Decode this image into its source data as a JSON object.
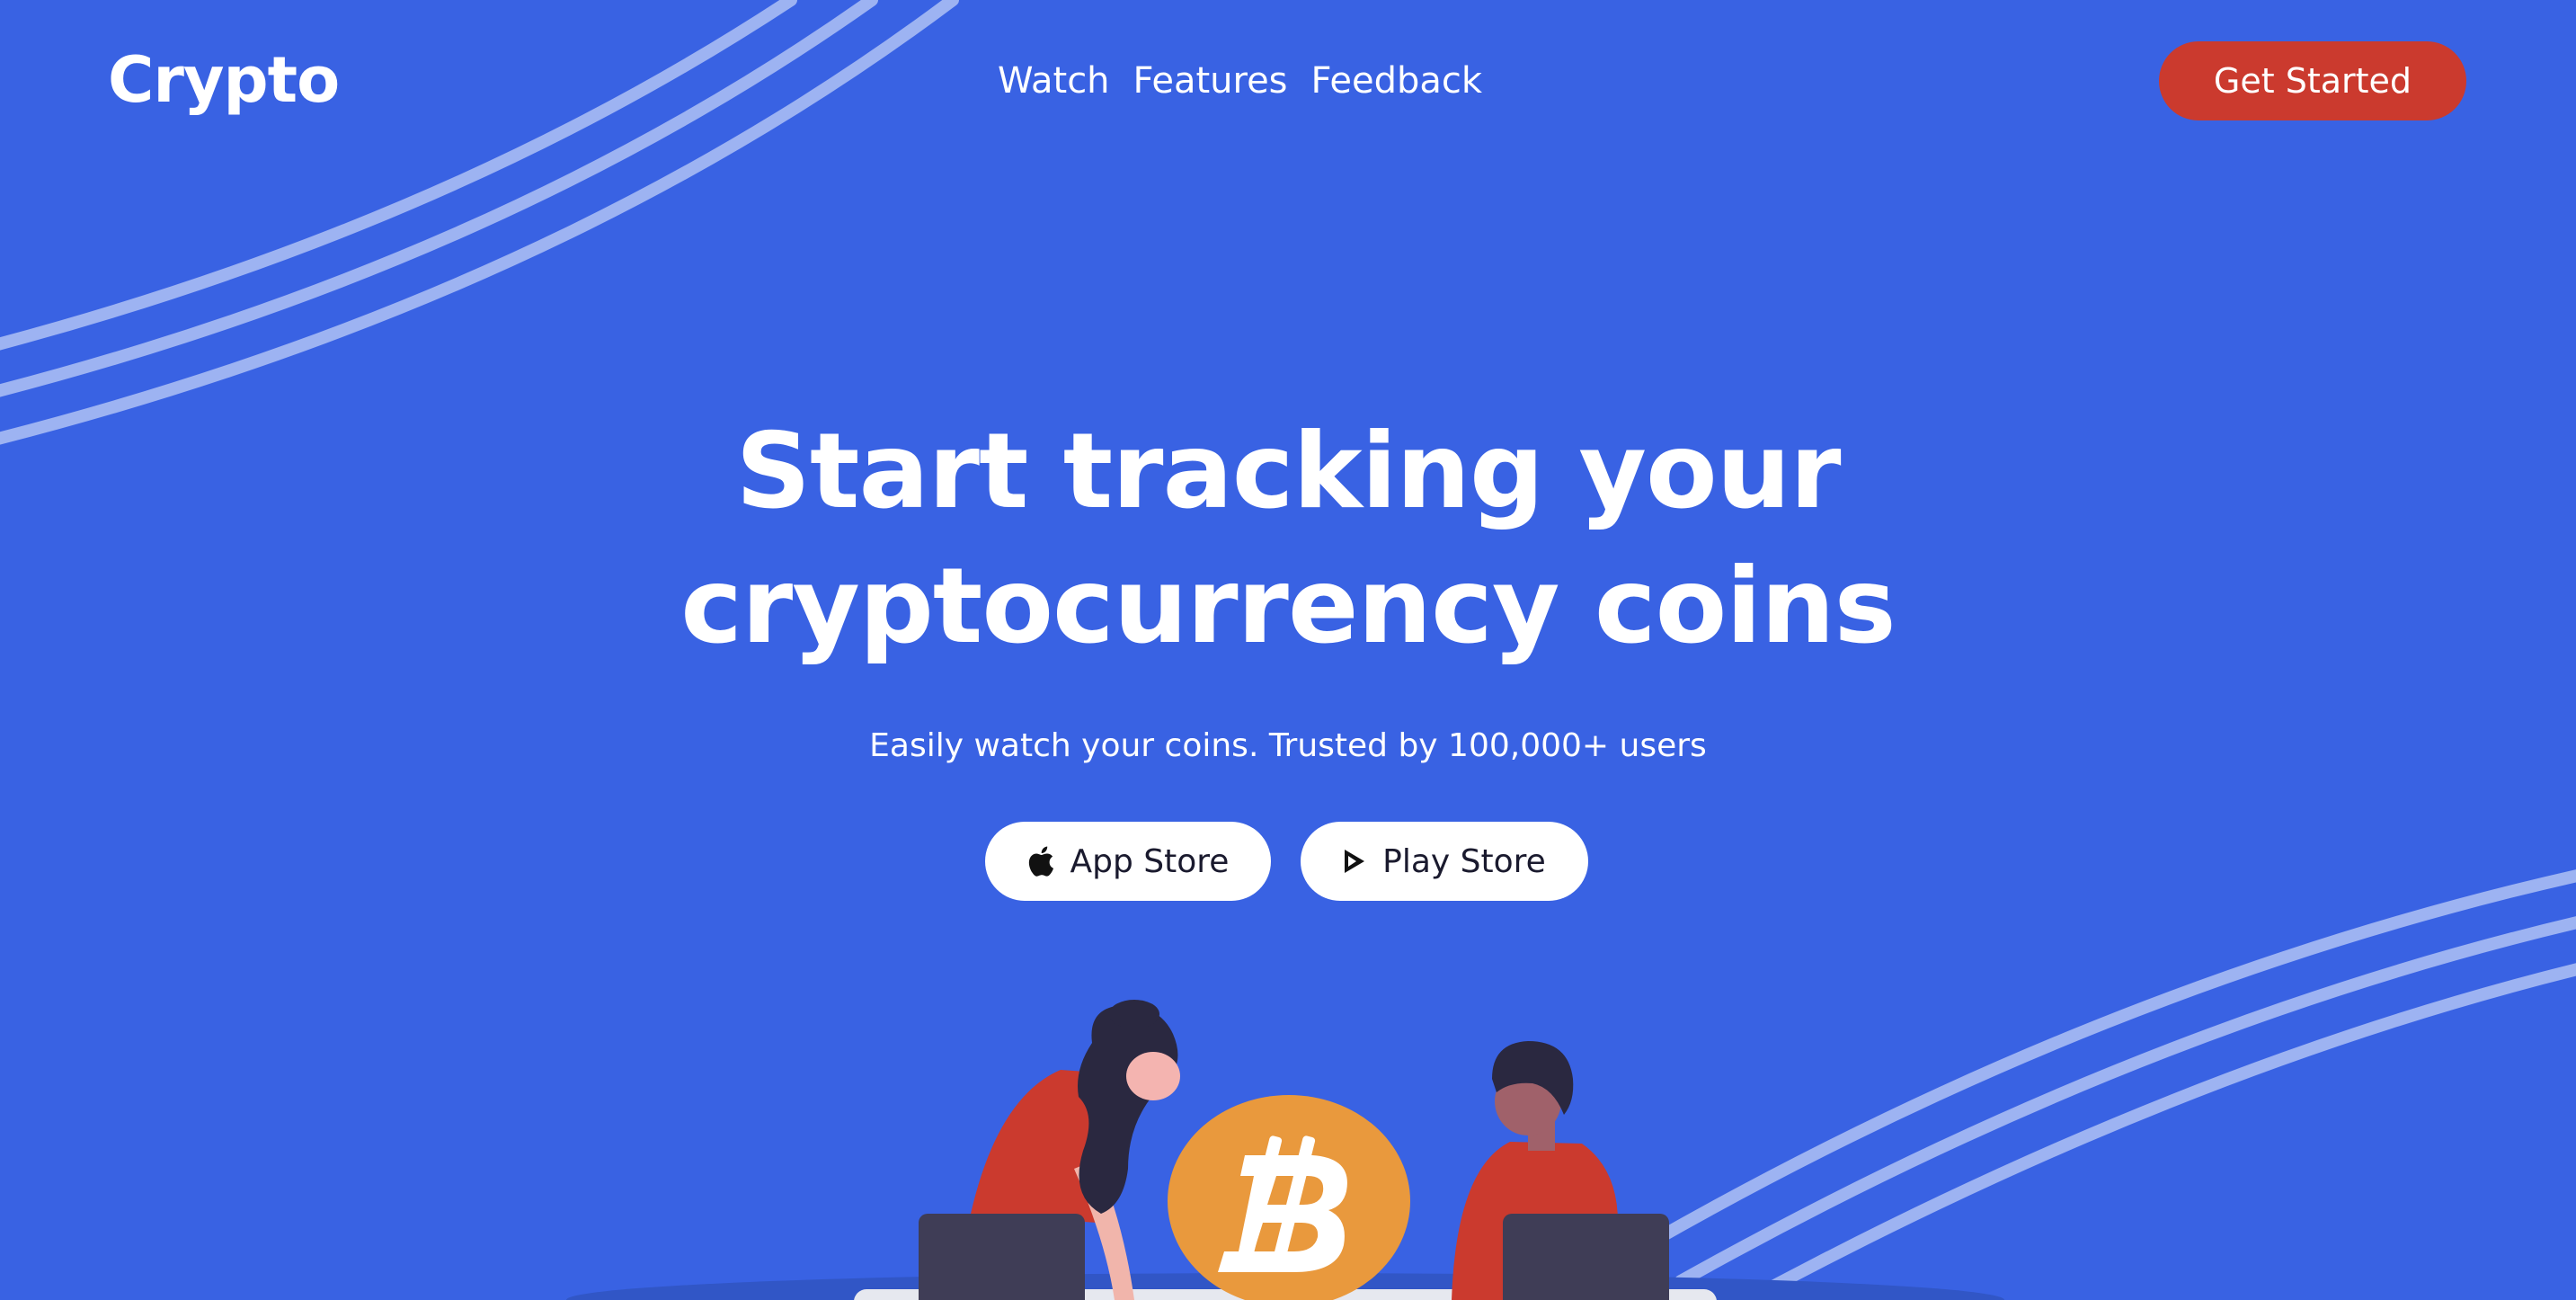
{
  "brand": {
    "name": "Crypto",
    "background_color": "#3962E3",
    "accent_color": "#CB3A2E",
    "coin_color": "#E9993D"
  },
  "nav": {
    "items": [
      {
        "label": "Watch"
      },
      {
        "label": "Features"
      },
      {
        "label": "Feedback"
      }
    ]
  },
  "header": {
    "cta_label": "Get Started"
  },
  "hero": {
    "title_line1": "Start tracking your",
    "title_line2": "cryptocurrency coins",
    "subtitle": "Easily watch your coins. Trusted by 100,000+ users",
    "buttons": [
      {
        "label": "App Store",
        "icon": "apple-icon"
      },
      {
        "label": "Play Store",
        "icon": "play-store-icon"
      }
    ]
  },
  "illustration": {
    "description_icon": "bitcoin-icon"
  }
}
